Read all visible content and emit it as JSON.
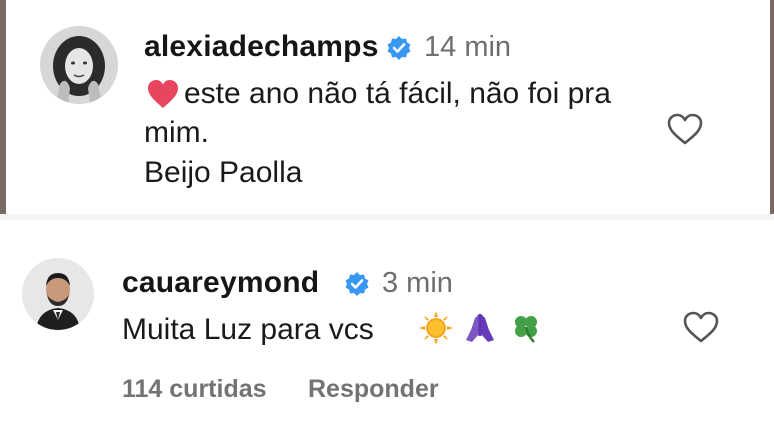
{
  "comments": [
    {
      "username": "alexiadechamps",
      "time": "14 min",
      "lines": [
        "este ano não tá fácil, não foi pra",
        "mim.",
        "Beijo Paolla"
      ],
      "leading_emoji": "red-heart",
      "avatar": "avatar-alexiadechamps"
    },
    {
      "username": "cauareymond",
      "time": "3 min",
      "text": "Muita Luz para vcs",
      "emojis": [
        "sun",
        "folded-hands",
        "four-leaf-clover"
      ],
      "likes_label": "114 curtidas",
      "reply_label": "Responder",
      "avatar": "avatar-cauareymond"
    }
  ],
  "colors": {
    "verified_blue": "#3897f0",
    "muted_gray": "#737373",
    "heart_red": "#e8455f"
  }
}
